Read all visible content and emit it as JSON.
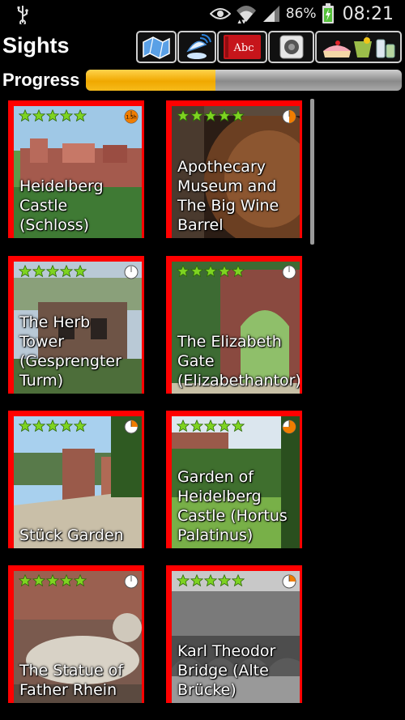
{
  "status_bar": {
    "battery_percent": "86%",
    "time": "08:21",
    "icons": [
      "usb-icon",
      "eye-icon",
      "wifi-icon",
      "signal-icon",
      "battery-charging-icon"
    ]
  },
  "header": {
    "title": "Sights",
    "tools": [
      {
        "name": "map-tool-button",
        "icon": "map-icon"
      },
      {
        "name": "radar-tool-button",
        "icon": "radar-icon"
      },
      {
        "name": "dictionary-tool-button",
        "icon": "abc-book-icon",
        "label": "Abc"
      },
      {
        "name": "audio-tool-button",
        "icon": "speaker-icon"
      },
      {
        "name": "food-tool-button",
        "icon": "food-drink-icon"
      }
    ]
  },
  "progress": {
    "label": "Progress",
    "value_fraction": 0.41
  },
  "sights": [
    {
      "title": "Heidelberg Castle (Schloss)",
      "stars": 5,
      "timer": "1.5h",
      "timer_fill": 1.0,
      "timer_color": "#f07d00"
    },
    {
      "title": "Apothecary Museum and The Big Wine Barrel",
      "stars": 5,
      "timer": "",
      "timer_fill": 0.5,
      "timer_color": "#f07d00"
    },
    {
      "title": "The Herb Tower (Gesprengter Turm)",
      "stars": 5,
      "timer": "",
      "timer_fill": 0.0,
      "timer_color": "#f07d00"
    },
    {
      "title": "The Elizabeth Gate (Elizabethantor)",
      "stars": 5,
      "timer": "",
      "timer_fill": 0.0,
      "timer_color": "#f07d00"
    },
    {
      "title": "Stück Garden",
      "stars": 5,
      "timer": "",
      "timer_fill": 0.25,
      "timer_color": "#f07d00"
    },
    {
      "title": "Garden of Heidelberg Castle (Hortus Palatinus)",
      "stars": 5,
      "timer": "",
      "timer_fill": 0.75,
      "timer_color": "#f07d00"
    },
    {
      "title": "The Statue of Father Rhein",
      "stars": 5,
      "timer": "",
      "timer_fill": 0.0,
      "timer_color": "#f07d00"
    },
    {
      "title": "Karl Theodor Bridge (Alte Brücke)",
      "stars": 5,
      "timer": "",
      "timer_fill": 0.25,
      "timer_color": "#f07d00"
    }
  ],
  "colors": {
    "card_border": "#ff0000",
    "star": "#7ed321",
    "progress_fill": "#f0a800",
    "progress_track": "#a8a8a8"
  }
}
